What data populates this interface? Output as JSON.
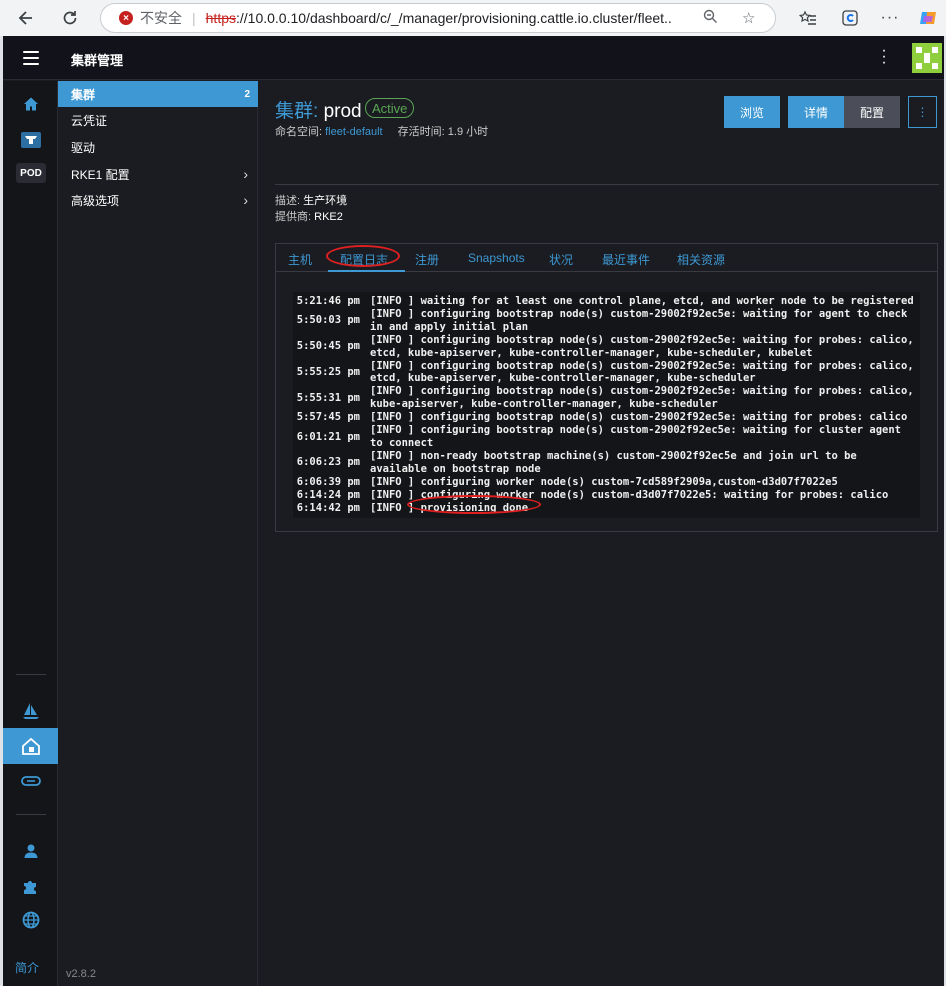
{
  "browser": {
    "insecure_label": "不安全",
    "url_scheme": "https",
    "url_rest": "://10.0.0.10/dashboard/c/_/manager/provisioning.cattle.io.cluster/fleet..."
  },
  "app": {
    "title": "集群管理",
    "version": "v2.8.2",
    "about_label": "简介",
    "pod_badge": "POD",
    "accent_color": "#3d98d3"
  },
  "sidebar": {
    "items": [
      {
        "label": "集群",
        "count": "2"
      },
      {
        "label": "云凭证"
      },
      {
        "label": "驱动"
      },
      {
        "label": "RKE1 配置",
        "chevron": "›"
      },
      {
        "label": "高级选项",
        "chevron": "›"
      }
    ]
  },
  "cluster": {
    "title_prefix": "集群:",
    "name": "prod",
    "status": "Active",
    "namespace_label": "命名空间:",
    "namespace": "fleet-default",
    "age_label": "存活时间:",
    "age": "1.9 小时",
    "description_label": "描述:",
    "description": "生产环境",
    "provider_label": "提供商:",
    "provider": "RKE2"
  },
  "actions": {
    "browse": "浏览",
    "detail": "详情",
    "config": "配置",
    "more": "⋮"
  },
  "tabs": [
    "主机",
    "配置日志",
    "注册",
    "Snapshots",
    "状况",
    "最近事件",
    "相关资源"
  ],
  "log": [
    {
      "time": "5:21:46 pm",
      "msg": "[INFO ] waiting for at least one control plane, etcd, and worker node to be registered"
    },
    {
      "time": "5:50:03 pm",
      "msg": "[INFO ] configuring bootstrap node(s) custom-29002f92ec5e: waiting for agent to check in and apply initial plan"
    },
    {
      "time": "5:50:45 pm",
      "msg": "[INFO ] configuring bootstrap node(s) custom-29002f92ec5e: waiting for probes: calico, etcd, kube-apiserver, kube-controller-manager, kube-scheduler, kubelet"
    },
    {
      "time": "5:55:25 pm",
      "msg": "[INFO ] configuring bootstrap node(s) custom-29002f92ec5e: waiting for probes: calico, etcd, kube-apiserver, kube-controller-manager, kube-scheduler"
    },
    {
      "time": "5:55:31 pm",
      "msg": "[INFO ] configuring bootstrap node(s) custom-29002f92ec5e: waiting for probes: calico, kube-apiserver, kube-controller-manager, kube-scheduler"
    },
    {
      "time": "5:57:45 pm",
      "msg": "[INFO ] configuring bootstrap node(s) custom-29002f92ec5e: waiting for probes: calico"
    },
    {
      "time": "6:01:21 pm",
      "msg": "[INFO ] configuring bootstrap node(s) custom-29002f92ec5e: waiting for cluster agent to connect"
    },
    {
      "time": "6:06:23 pm",
      "msg": "[INFO ] non-ready bootstrap machine(s) custom-29002f92ec5e and join url to be available on bootstrap node"
    },
    {
      "time": "6:06:39 pm",
      "msg": "[INFO ] configuring worker node(s) custom-7cd589f2909a,custom-d3d07f7022e5"
    },
    {
      "time": "6:14:24 pm",
      "msg": "[INFO ] configuring worker node(s) custom-d3d07f7022e5: waiting for probes: calico"
    },
    {
      "time": "6:14:42 pm",
      "msg": "[INFO ] provisioning done"
    }
  ]
}
